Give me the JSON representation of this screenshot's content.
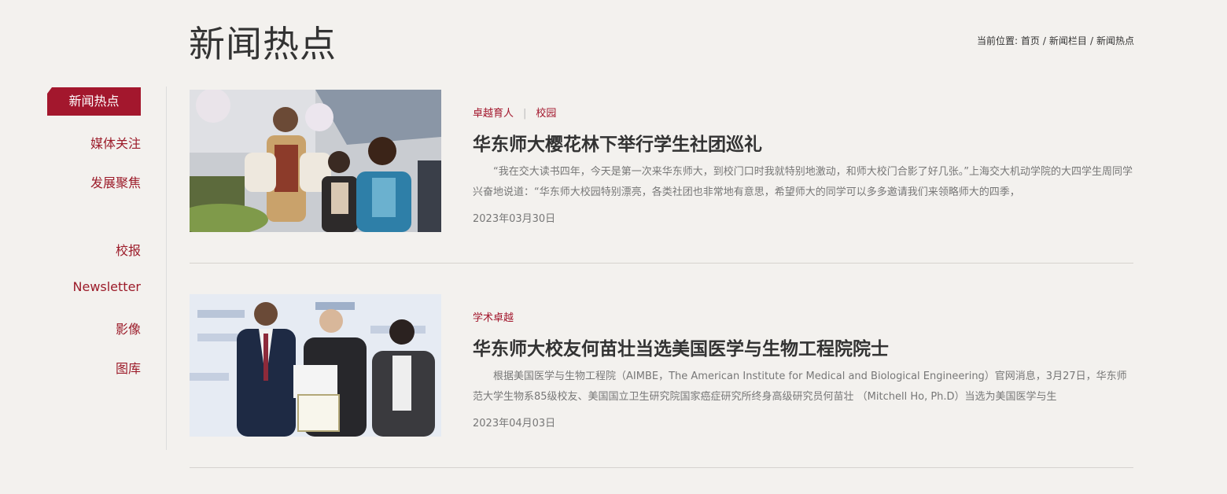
{
  "page": {
    "title": "新闻热点"
  },
  "breadcrumb": {
    "prefix": "当前位置:",
    "items": [
      "首页",
      "新闻栏目",
      "新闻热点"
    ]
  },
  "sidebar": {
    "items": [
      {
        "label": "新闻热点",
        "active": true
      },
      {
        "label": "媒体关注"
      },
      {
        "label": "发展聚焦"
      },
      {
        "label": "校报"
      },
      {
        "label": "Newsletter"
      },
      {
        "label": "影像"
      },
      {
        "label": "图库"
      }
    ]
  },
  "news": [
    {
      "tags": [
        "卓越育人",
        "校园"
      ],
      "title": "华东师大樱花林下举行学生社团巡礼",
      "summary": "“我在交大读书四年，今天是第一次来华东师大，到校门口时我就特别地激动，和师大校门合影了好几张。”上海交大机动学院的大四学生周同学兴奋地说道：“华东师大校园特别漂亮，各类社团也非常地有意思，希望师大的同学可以多多邀请我们来领略师大的四季，",
      "date": "2023年03月30日"
    },
    {
      "tags": [
        "学术卓越"
      ],
      "title": "华东师大校友何苗壮当选美国医学与生物工程院院士",
      "summary": "根据美国医学与生物工程院（AIMBE，The American Institute for Medical and Biological Engineering）官网消息，3月27日，华东师范大学生物系85级校友、美国国立卫生研究院国家癌症研究所终身高级研究员何苗壮 （Mitchell Ho, Ph.D）当选为美国医学与生",
      "date": "2023年04月03日"
    }
  ],
  "colors": {
    "accent": "#a3172d",
    "background": "#f3f1ee"
  }
}
